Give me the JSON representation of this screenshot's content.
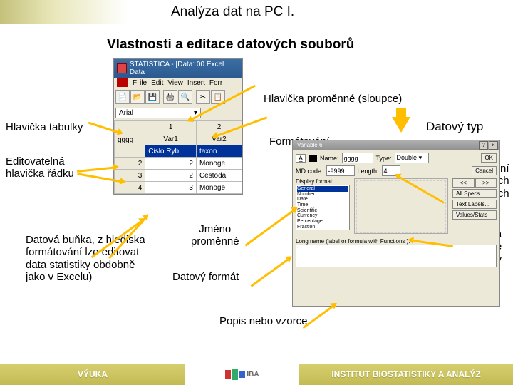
{
  "page": {
    "title": "Analýza dat na PC I.",
    "subtitle": "Vlastnosti a editace datových souborů"
  },
  "labels": {
    "hlavicka_sloupce": "Hlavička proměnné (sloupce)",
    "hlavicka_tabulky": "Hlavička tabulky",
    "datovy_typ": "Datový typ",
    "formatovani": "Formátování",
    "editovatelna_hlavicka": "Editovatelná\nhlavička řádku",
    "nastaveni_promennych": "Nastavení\nvšech\nproměnných",
    "jmeno_promenne": "Jméno\nproměnné",
    "textove_ciselne": "Textové a\nčíselné\nhodnoty",
    "datova_bunka": "Datová buňka, z hlediska\nformátování lze editovat\ndata statistiky obdobně\njako v Excelu)",
    "datovy_format": "Datový formát",
    "popis_vzorce": "Popis nebo vzorce"
  },
  "app": {
    "title": "STATISTICA - [Data: 00 Excel Data",
    "menu": {
      "file": "File",
      "edit": "Edit",
      "view": "View",
      "insert": "Insert",
      "for": "Forr"
    },
    "font": "Arial",
    "columns": [
      {
        "num": "1",
        "name": "Var1"
      },
      {
        "num": "2",
        "name": "Var2"
      }
    ],
    "corner": "gggg",
    "rows": [
      {
        "h": "",
        "c1": "Cislo.Ryb",
        "c2": "taxon"
      },
      {
        "h": "2",
        "c1": "2",
        "c2": "Monoge"
      },
      {
        "h": "3",
        "c1": "2",
        "c2": "Cestoda"
      },
      {
        "h": "4",
        "c1": "3",
        "c2": "Monoge"
      }
    ]
  },
  "dialog": {
    "var_label": "Variable 6",
    "name_field": "gggg",
    "length_field": "4",
    "display_label": "Display format:",
    "formats": [
      "General",
      "Number",
      "Date",
      "Time",
      "Scientific",
      "Currency",
      "Percentage",
      "Fraction"
    ],
    "buttons": {
      "ok": "OK",
      "cancel": "Cancel",
      "prev": "<<",
      "next": ">>",
      "all": "All Specs...",
      "txt": "Text Labels...",
      "val": "Values/Stats"
    },
    "long_label": "Long name (label or formula with Functions ):"
  },
  "footer": {
    "left": "VÝUKA",
    "logo": "IBA",
    "right": "INSTITUT BIOSTATISTIKY A ANALÝZ"
  }
}
